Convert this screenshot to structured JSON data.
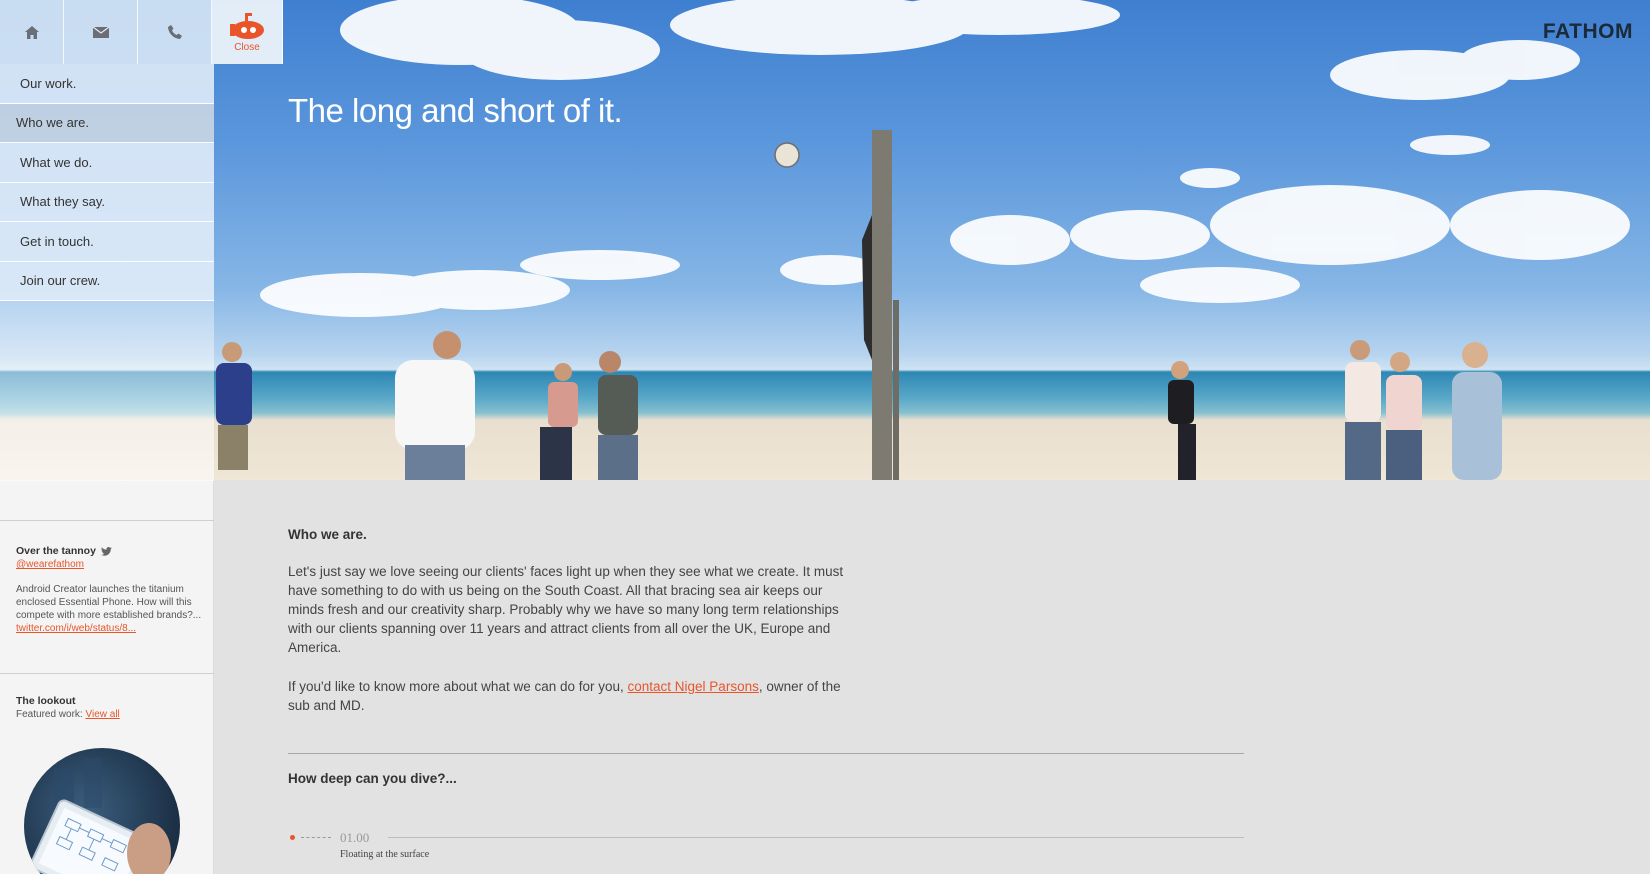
{
  "topbar": {
    "home_icon": "home-icon",
    "mail_icon": "mail-icon",
    "phone_icon": "phone-icon",
    "submarine_icon": "submarine-icon",
    "close_label": "Close",
    "accent": "#e8552b"
  },
  "brand": {
    "logo": "FATHOM"
  },
  "hero": {
    "title": "The long and short of it."
  },
  "nav": {
    "items": [
      {
        "label": "Our work."
      },
      {
        "label": "Who we are."
      },
      {
        "label": "What we do."
      },
      {
        "label": "What they say."
      },
      {
        "label": "Get in touch."
      },
      {
        "label": "Join our crew."
      }
    ],
    "active": "Who we are."
  },
  "tannoy": {
    "heading": "Over the tannoy",
    "handle": "@wearefathom",
    "text": "Android Creator launches the titanium enclosed Essential Phone. How will this compete with more established brands?...",
    "link": "twitter.com/i/web/status/8..."
  },
  "lookout": {
    "heading": "The lookout",
    "featured_label": "Featured work:",
    "view_all": "View all"
  },
  "main": {
    "title": "Who we are.",
    "paragraph1": "Let's just say we love seeing our clients' faces light up when they see what we create. It must have something to do with us being on the South Coast. All that bracing sea air keeps our minds fresh and our creativity sharp. Probably why we have so many long term relationships with our clients spanning over 11 years and attract clients from all over the UK, Europe and America.",
    "paragraph2_before": "If you'd like to know more about what we can do for you, ",
    "paragraph2_link": "contact Nigel Parsons",
    "paragraph2_after": ", owner of the sub and MD."
  },
  "dive": {
    "title": "How deep can you dive?...",
    "depth": "01.00",
    "caption": "Floating at the surface"
  }
}
